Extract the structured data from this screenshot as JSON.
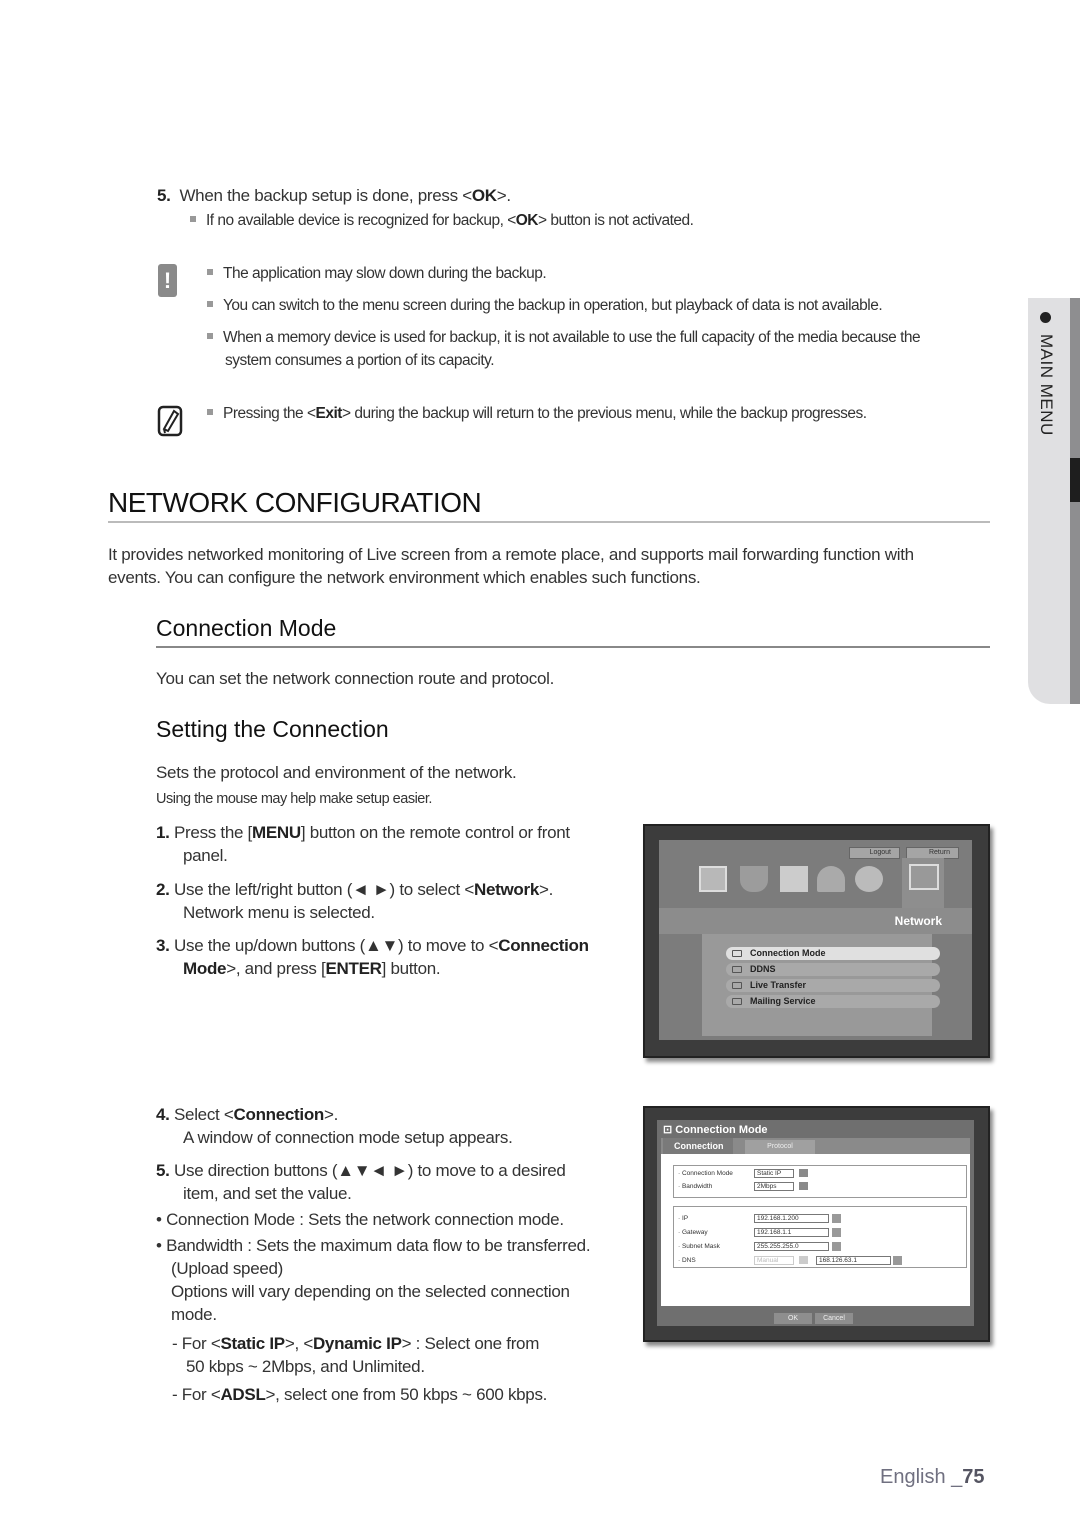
{
  "backup": {
    "step5_num": "5.",
    "step5_a": "When the backup setup is done, press <",
    "step5_ok": "OK",
    "step5_b": ">.",
    "sub_note_a": "If no available device is recognized for backup, <",
    "sub_note_ok": "OK",
    "sub_note_b": "> button is not activated.",
    "caution_icon": "exclamation-icon",
    "caution_items": [
      "The application may slow down during the backup.",
      "You can switch to the menu screen during the backup in operation, but playback of data is not available.",
      "When a memory device is used for backup, it is not available to use the full capacity of the media because the",
      "system consumes a portion of its capacity."
    ],
    "note_icon": "pencil-note-icon",
    "note_a": "Pressing the <",
    "note_exit": "Exit",
    "note_b": "> during the backup will return to the previous menu, while the backup progresses."
  },
  "side_tab": {
    "label": "MAIN MENU"
  },
  "section": {
    "title": "NETWORK CONFIGURATION",
    "intro_1": "It provides networked monitoring of Live screen from a remote place, and supports mail forwarding function with",
    "intro_2": "events. You can configure the network environment which enables such functions.",
    "sub_title": "Connection Mode",
    "sub_desc": "You can set the network connection route and protocol.",
    "sub2_title": "Setting the Connection",
    "sub2_desc": "Sets the protocol and environment of the network.",
    "sub2_hint": "Using the mouse may help make setup easier."
  },
  "steps": {
    "s1_num": "1.",
    "s1_a": "Press the [",
    "s1_b": "MENU",
    "s1_c": "] button on the remote control or front",
    "s1_d": "panel.",
    "s2_num": "2.",
    "s2_a": "Use the left/right button (◄ ►) to select <",
    "s2_b": "Network",
    "s2_c": ">.",
    "s2_d": "Network menu is selected.",
    "s3_num": "3.",
    "s3_a": "Use the up/down buttons (▲▼) to move to <",
    "s3_b": "Connection",
    "s3_c": "Mode",
    "s3_d": ">, and press [",
    "s3_e": "ENTER",
    "s3_f": "] button.",
    "s4_num": "4.",
    "s4_a": "Select <",
    "s4_b": "Connection",
    "s4_c": ">.",
    "s4_d": "A window of connection mode setup appears.",
    "s5_num": "5.",
    "s5_a": "Use direction buttons (▲▼◄ ►) to move to a desired",
    "s5_b": "item, and set the value.",
    "bullet1": "Connection Mode : Sets the network connection mode.",
    "bullet2_a": "Bandwidth : Sets the maximum data flow to be transferred.",
    "bullet2_b": "(Upload speed)",
    "bullet2_c": "Options will vary depending on the selected connection",
    "bullet2_d": "mode.",
    "dash1_a": "For <",
    "dash1_b": "Static IP",
    "dash1_c": ">, <",
    "dash1_d": "Dynamic IP",
    "dash1_e": "> : Select one from",
    "dash1_f": "50 kbps ~ 2Mbps, and Unlimited.",
    "dash2_a": "For <",
    "dash2_b": "ADSL",
    "dash2_c": ">, select one from 50 kbps ~ 600 kbps."
  },
  "network_screen": {
    "logout_label": "Logout",
    "return_label": "Return",
    "icons": [
      "monitor-settings-icon",
      "camera-dome-icon",
      "record-schedule-icon",
      "alarm-icon",
      "backup-disc-icon",
      "network-icon"
    ],
    "active_tab": "Network",
    "menu_items": [
      {
        "label": "Connection Mode",
        "selected": true
      },
      {
        "label": "DDNS",
        "selected": false
      },
      {
        "label": "Live Transfer",
        "selected": false
      },
      {
        "label": "Mailing Service",
        "selected": false
      }
    ]
  },
  "conn_dialog": {
    "title": "Connection Mode",
    "tabs": [
      "Connection",
      "Protocol"
    ],
    "active_tab": "Connection",
    "fields": {
      "connection_mode_label": "· Connection Mode",
      "connection_mode_value": "Static IP",
      "bandwidth_label": "· Bandwidth",
      "bandwidth_value": "2Mbps",
      "ip_label": "· IP",
      "ip_value": "192.168.1.200",
      "gateway_label": "· Gateway",
      "gateway_value": "192.168.1.1",
      "subnet_label": "· Subnet Mask",
      "subnet_value": "255.255.255.0",
      "dns_label": "· DNS",
      "dns_mode_value": "Manual",
      "dns_value": "168.126.63.1"
    },
    "ok_label": "OK",
    "cancel_label": "Cancel"
  },
  "footer": {
    "lang": "English _",
    "page": "75"
  }
}
